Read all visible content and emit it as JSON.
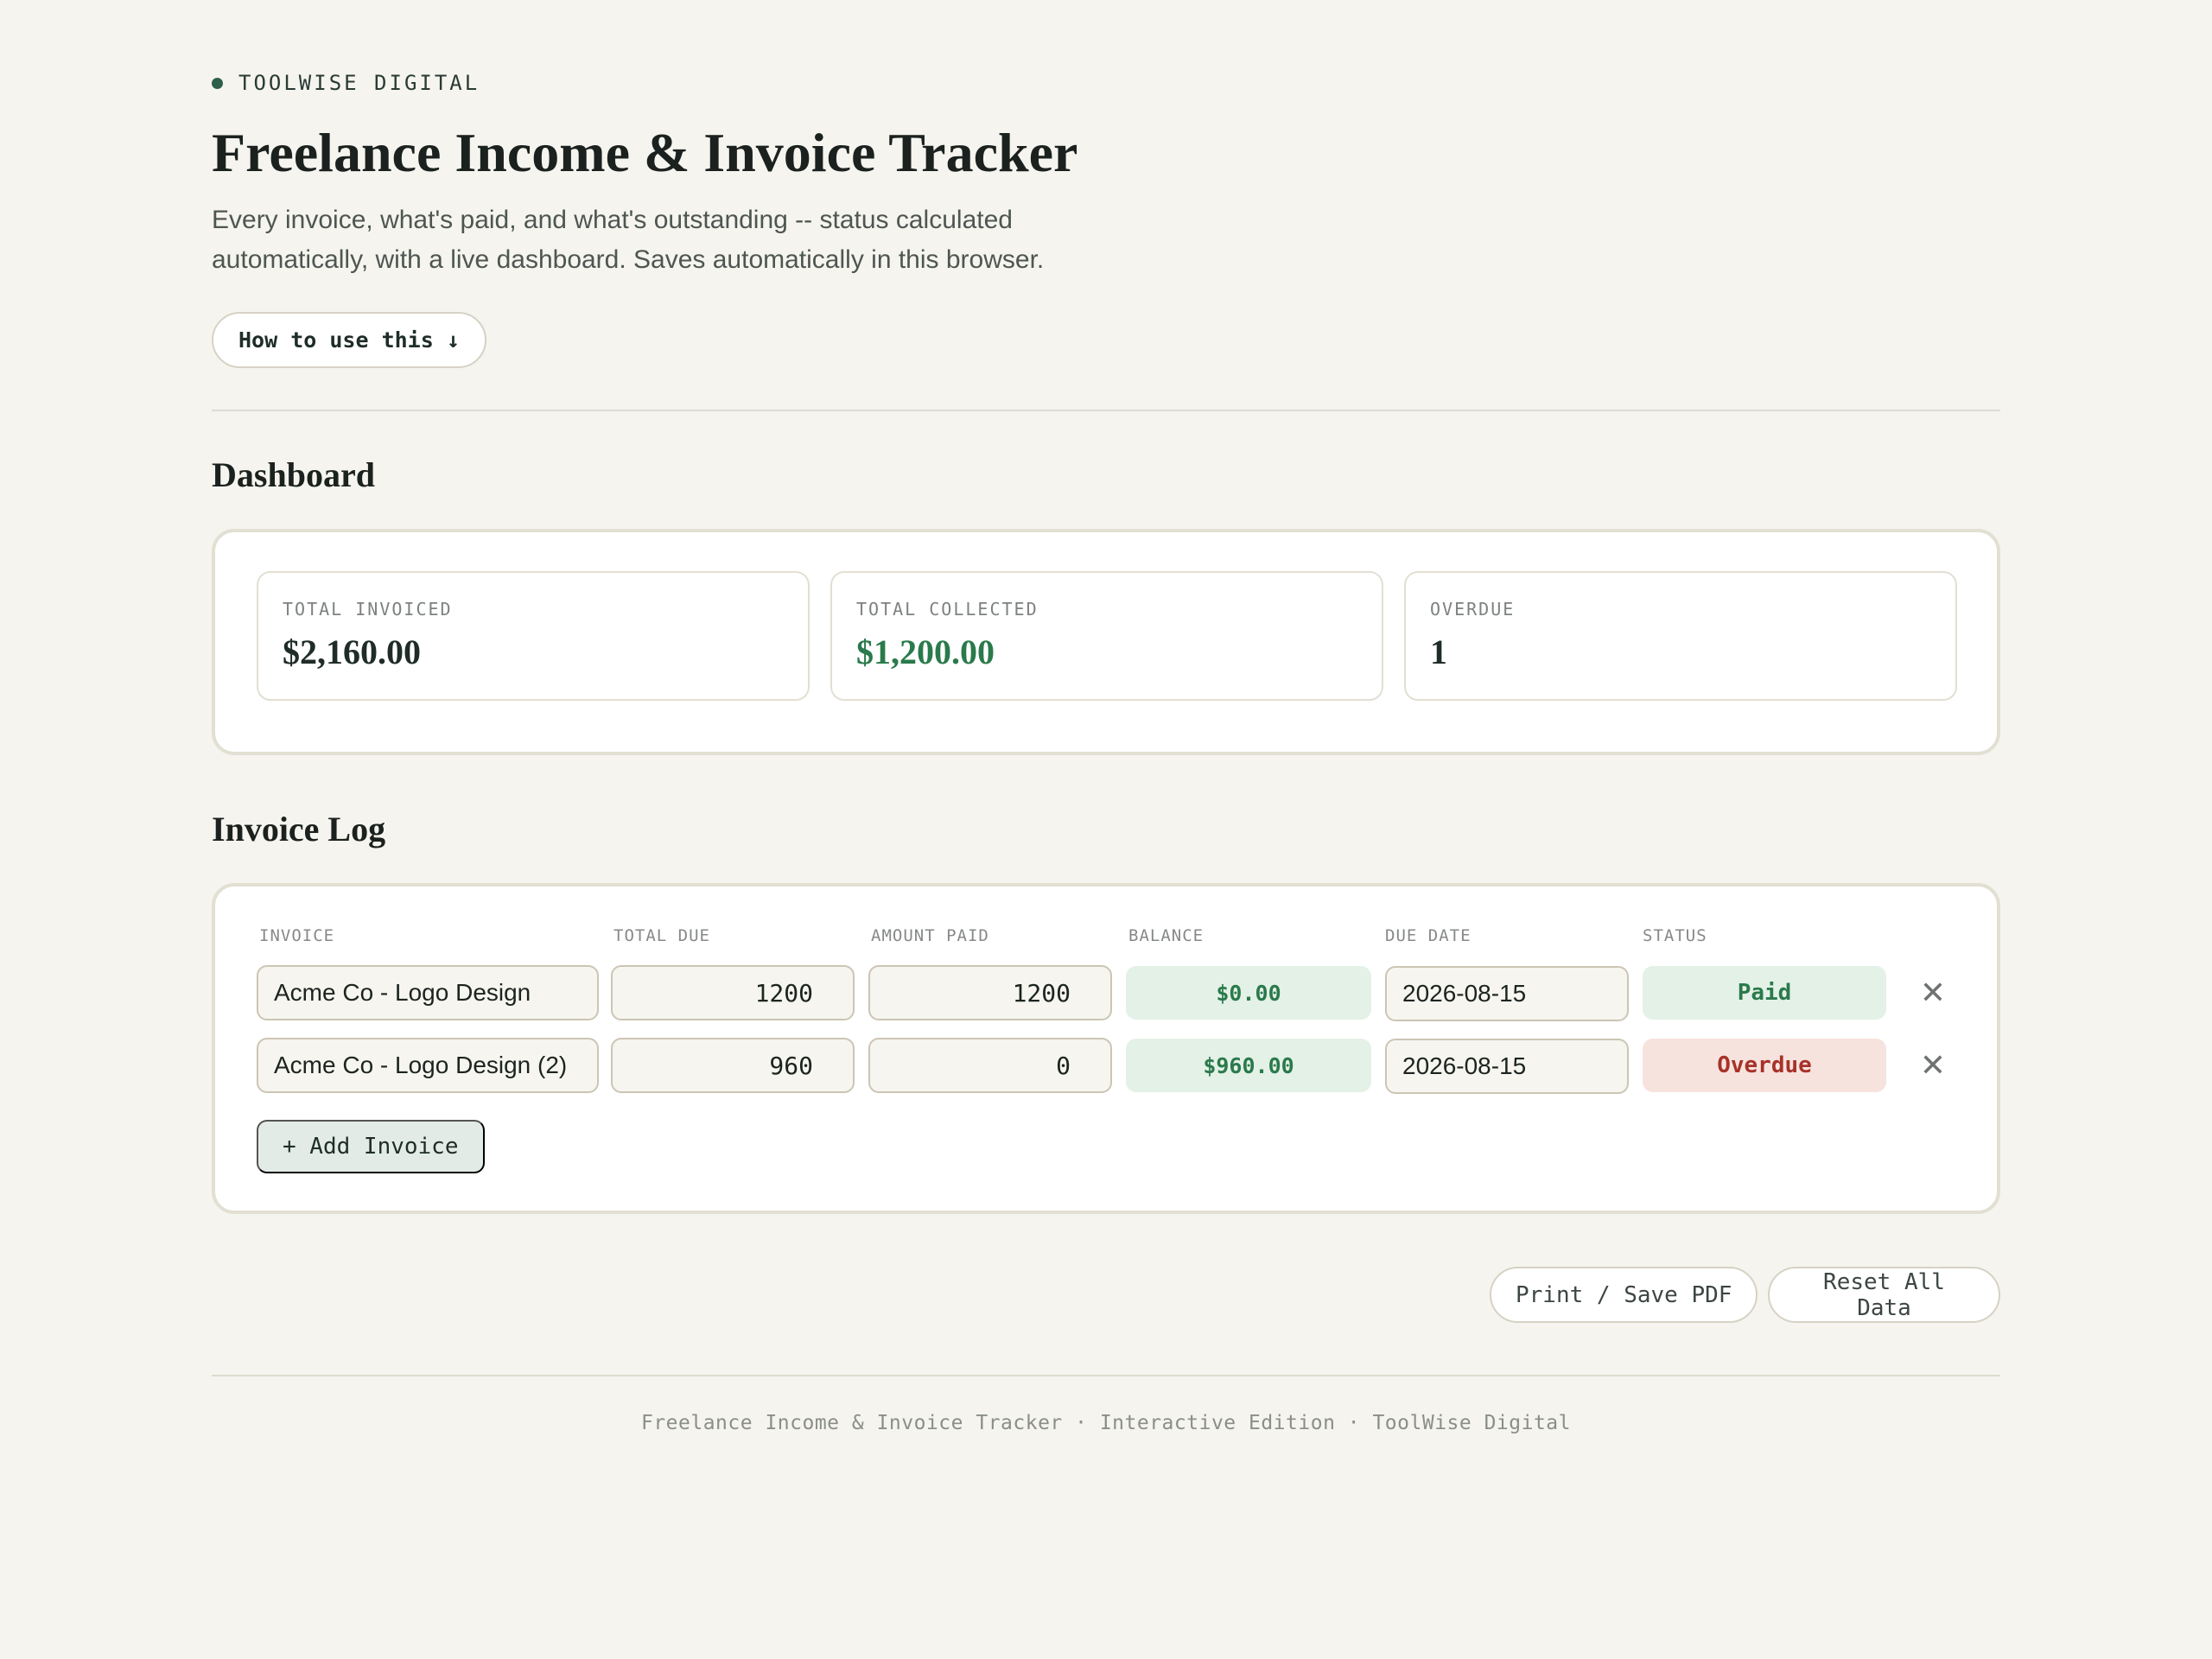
{
  "header": {
    "brand": "TOOLWISE DIGITAL",
    "title": "Freelance Income & Invoice Tracker",
    "subtitle": "Every invoice, what's paid, and what's outstanding -- status calculated automatically, with a live dashboard. Saves automatically in this browser.",
    "howto_label": "How to use this ↓"
  },
  "dashboard": {
    "title": "Dashboard",
    "stats": [
      {
        "label": "TOTAL INVOICED",
        "value": "$2,160.00"
      },
      {
        "label": "TOTAL COLLECTED",
        "value": "$1,200.00"
      },
      {
        "label": "OVERDUE",
        "value": "1"
      }
    ]
  },
  "invoice_log": {
    "title": "Invoice Log",
    "columns": [
      "INVOICE",
      "TOTAL DUE",
      "AMOUNT PAID",
      "BALANCE",
      "DUE DATE",
      "STATUS"
    ],
    "rows": [
      {
        "invoice": "Acme Co - Logo Design",
        "total_due": "1200",
        "amount_paid": "1200",
        "balance": "$0.00",
        "due_date": "2026-08-15",
        "status": "Paid"
      },
      {
        "invoice": "Acme Co - Logo Design (2)",
        "total_due": "960",
        "amount_paid": "0",
        "balance": "$960.00",
        "due_date": "2026-08-15",
        "status": "Overdue"
      }
    ],
    "delete_glyph": "✕",
    "add_label": "+ Add Invoice"
  },
  "actions": {
    "print_label": "Print / Save PDF",
    "reset_label": "Reset All Data"
  },
  "footer": {
    "text": "Freelance Income & Invoice Tracker · Interactive Edition · ToolWise Digital"
  },
  "colors": {
    "background": "#f5f4ef",
    "accent_green": "#2a7a4b",
    "overdue_red": "#a8322a"
  }
}
